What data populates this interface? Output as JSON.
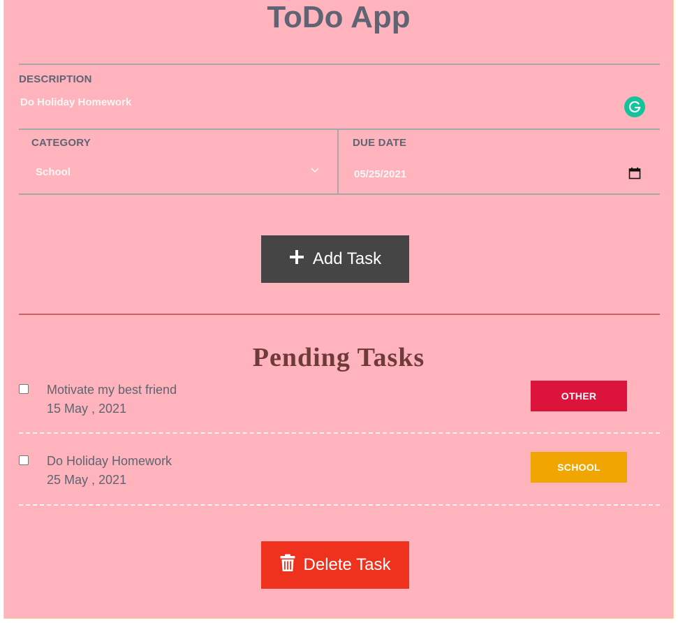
{
  "app": {
    "title": "ToDo App"
  },
  "form": {
    "description": {
      "label": "DESCRIPTION",
      "value": "Do Holiday Homework"
    },
    "category": {
      "label": "CATEGORY",
      "value": "School"
    },
    "due_date": {
      "label": "DUE DATE",
      "value": "05/25/2021"
    }
  },
  "buttons": {
    "add": "Add Task",
    "delete": "Delete Task"
  },
  "pending": {
    "title": "Pending Tasks",
    "tasks": [
      {
        "text": "Motivate my best friend",
        "date": "15 May , 2021",
        "category": "OTHER",
        "color": "#dc143c",
        "checked": false
      },
      {
        "text": "Do Holiday Homework",
        "date": "25 May , 2021",
        "category": "SCHOOL",
        "color": "#f0a500",
        "checked": false
      }
    ]
  },
  "colors": {
    "background": "#ffb3bd",
    "add_button": "#454545",
    "delete_button": "#ee321e",
    "grammarly": "#15c39a"
  },
  "icons": {
    "add": "plus-icon",
    "delete": "trash-icon",
    "grammarly": "grammarly-icon",
    "category": "chevron-down-icon",
    "due_date": "calendar-icon"
  }
}
